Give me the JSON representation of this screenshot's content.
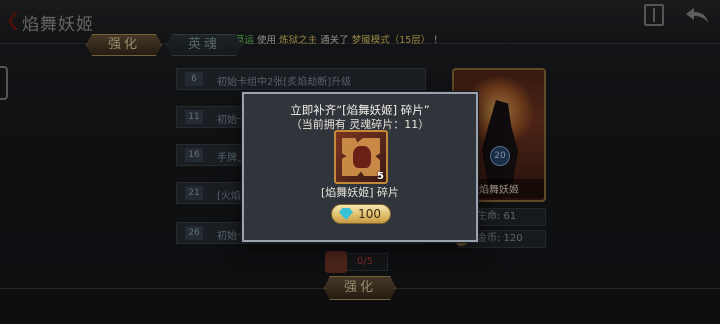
{
  "header": {
    "title": "焰舞妖姬"
  },
  "marquee": {
    "player": "四叶草运",
    "verb1": "使用",
    "hero": "炼狱之主",
    "verb2": "通关了",
    "mode": "梦魇模式（15层）",
    "end": "！"
  },
  "tabs": [
    {
      "label": "强化"
    },
    {
      "label": "英魂"
    }
  ],
  "list": [
    {
      "num": "6",
      "text": "初始卡组中2张[炙焰劫断]升级"
    },
    {
      "num": "11",
      "text": "初始卡组中"
    },
    {
      "num": "16",
      "text": "手牌上限+1"
    },
    {
      "num": "21",
      "text": "[火焰..."
    },
    {
      "num": "26",
      "text": "初始卡组升级"
    }
  ],
  "hero_card": {
    "name": "焰舞妖姬",
    "level": "20"
  },
  "stats": {
    "hp": "生命: 61",
    "gold": "金币: 120"
  },
  "material": {
    "count": "0/5"
  },
  "bottom": {
    "strengthen": "强化"
  },
  "modal": {
    "line1": "立即补齐“[焰舞妖姬] 碎片”",
    "line2": "（当前拥有 灵魂碎片：11）",
    "fragment_qty": "5",
    "fragment_name": "[焰舞妖姬] 碎片",
    "price": "100"
  },
  "colors": {
    "accent_gold": "#b99a62",
    "highlight_green": "#6fe06a",
    "highlight_yellow": "#f1d86a",
    "gem_cyan": "#36c1d6"
  },
  "icons": [
    "back-icon",
    "book-icon",
    "return-arrow-icon",
    "soul-gem-icon",
    "coin-icon",
    "fragment-icon"
  ]
}
